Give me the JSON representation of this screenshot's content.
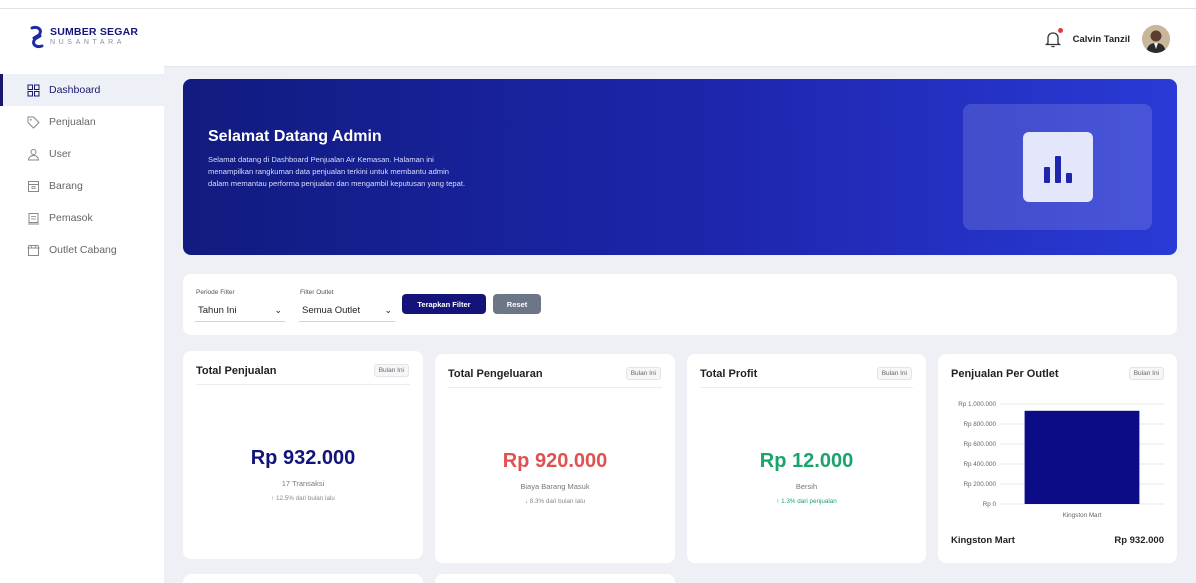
{
  "brand": {
    "name": "SUMBER SEGAR",
    "sub": "NUSANTARA"
  },
  "user": {
    "name": "Calvin Tanzil"
  },
  "colors": {
    "primary": "#13137a",
    "accent_red": "#e53935",
    "accent_green": "#1aa36b",
    "hero_start": "#111b7f",
    "hero_end": "#2a3ad6"
  },
  "sidebar": {
    "items": [
      {
        "label": "Dashboard",
        "icon": "dashboard-icon",
        "active": true
      },
      {
        "label": "Penjualan",
        "icon": "tag-icon"
      },
      {
        "label": "User",
        "icon": "user-icon"
      },
      {
        "label": "Barang",
        "icon": "box-icon"
      },
      {
        "label": "Pemasok",
        "icon": "clipboard-icon"
      },
      {
        "label": "Outlet Cabang",
        "icon": "store-icon"
      }
    ]
  },
  "hero": {
    "title": "Selamat Datang Admin",
    "description": "Selamat datang di Dashboard Penjualan Air Kemasan. Halaman ini menampilkan rangkuman data penjualan terkini untuk membantu admin dalam memantau performa penjualan dan mengambil keputusan yang tepat.",
    "icon": "bar-chart-icon"
  },
  "filter": {
    "period_label": "Periode Filter",
    "period_value": "Tahun Ini",
    "outlet_label": "Filter Outlet",
    "outlet_value": "Semua Outlet",
    "apply_label": "Terapkan Filter",
    "reset_label": "Reset"
  },
  "cards": {
    "sales": {
      "title": "Total Penjualan",
      "badge": "Bulan Ini",
      "value": "Rp 932.000",
      "sub": "17 Transaksi",
      "trend": "↑ 12.5% dari bulan lalu"
    },
    "expense": {
      "title": "Total Pengeluaran",
      "badge": "Bulan Ini",
      "value": "Rp 920.000",
      "sub": "Biaya Barang Masuk",
      "trend": "↓ 8.3% dari bulan lalu"
    },
    "profit": {
      "title": "Total Profit",
      "badge": "Bulan Ini",
      "value": "Rp 12.000",
      "sub": "Bersih",
      "trend": "↑ 1.3% dari penjualan"
    },
    "outlet": {
      "title": "Penjualan Per Outlet",
      "badge": "Bulan Ini",
      "outlet_name": "Kingston Mart",
      "outlet_value": "Rp 932.000"
    }
  },
  "chart_data": {
    "type": "bar",
    "categories": [
      "Kingston Mart"
    ],
    "values": [
      932000
    ],
    "ylim": [
      0,
      1000000
    ],
    "yticks": [
      "Rp 1.000.000",
      "Rp 800.000",
      "Rp 600.000",
      "Rp 400.000",
      "Rp 200.000",
      "Rp 0"
    ],
    "bar_color": "#0c0c87",
    "grid": true
  }
}
